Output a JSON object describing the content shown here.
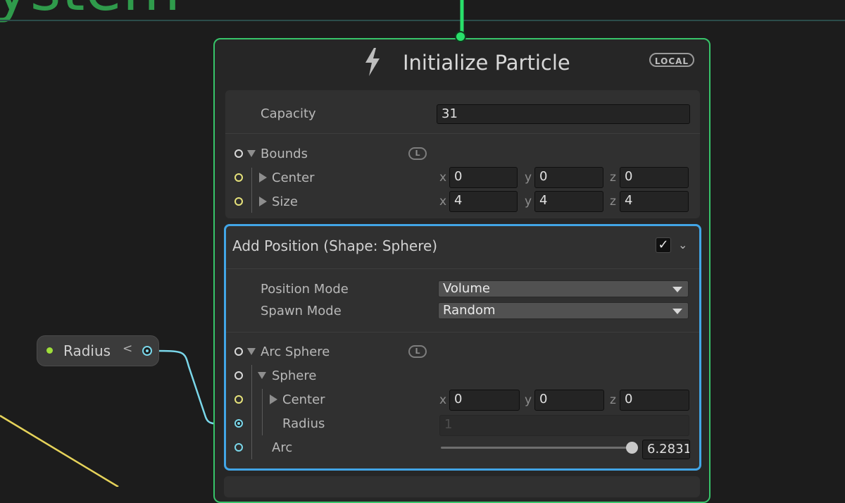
{
  "background": {
    "title_fragment": "ystem"
  },
  "node": {
    "title": "Initialize Particle",
    "space_badge": "LOCAL",
    "capacity": {
      "label": "Capacity",
      "value": "31"
    },
    "bounds": {
      "label": "Bounds",
      "space_badge": "L",
      "center": {
        "label": "Center",
        "x": "0",
        "y": "0",
        "z": "0"
      },
      "size": {
        "label": "Size",
        "x": "4",
        "y": "4",
        "z": "4"
      }
    },
    "axis_labels": {
      "x": "x",
      "y": "y",
      "z": "z"
    }
  },
  "block": {
    "title": "Add Position (Shape: Sphere)",
    "enabled": true,
    "enabled_glyph": "✓",
    "collapse_glyph": "⌄",
    "position_mode": {
      "label": "Position Mode",
      "value": "Volume"
    },
    "spawn_mode": {
      "label": "Spawn Mode",
      "value": "Random"
    },
    "arc_sphere": {
      "label": "Arc Sphere",
      "space_badge": "L",
      "sphere": {
        "label": "Sphere",
        "center": {
          "label": "Center",
          "x": "0",
          "y": "0",
          "z": "0"
        },
        "radius": {
          "label": "Radius",
          "value": "1"
        }
      },
      "arc": {
        "label": "Arc",
        "value": "6.2831",
        "fraction": 1.0
      }
    }
  },
  "radius_property_node": {
    "label": "Radius",
    "collapse_glyph": "<"
  },
  "colors": {
    "flow_wire": "#29e06a",
    "float_wire": "#7ad7ea",
    "vector_wire": "#e6d35a",
    "node_border": "#37c46a",
    "block_selected_border": "#42a5e6"
  }
}
